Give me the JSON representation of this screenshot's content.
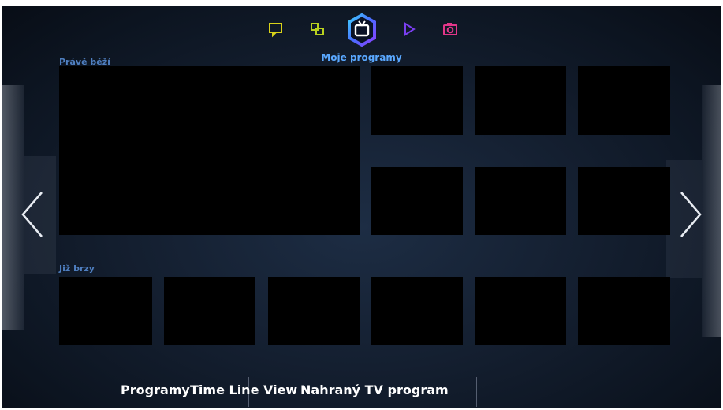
{
  "header": {
    "title": "Moje programy",
    "icons": [
      {
        "name": "social-icon",
        "color": "#d8d21a"
      },
      {
        "name": "apps-icon",
        "color": "#b9d21f"
      },
      {
        "name": "tv-icon",
        "color": "#ffffff",
        "active": true
      },
      {
        "name": "play-icon",
        "color": "#7a3ff0"
      },
      {
        "name": "camera-icon",
        "color": "#e3368a"
      }
    ]
  },
  "sections": {
    "now_label": "Právě běží",
    "soon_label": "Již brzy"
  },
  "bottom_menu": {
    "items": [
      "Programy",
      "Time Line View",
      "Nahraný TV program"
    ]
  },
  "colors": {
    "accent": "#5aa8ff",
    "section_label": "#4f7fc0",
    "background": "#141f30"
  }
}
